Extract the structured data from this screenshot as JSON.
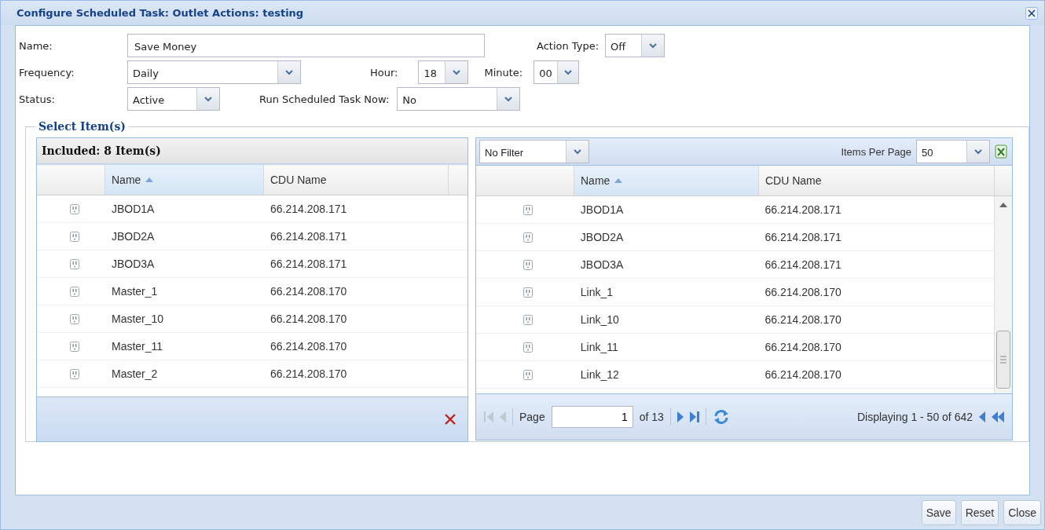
{
  "window": {
    "title": "Configure Scheduled Task: Outlet Actions: testing"
  },
  "form": {
    "name": {
      "label": "Name:",
      "value": "Save Money"
    },
    "action_type": {
      "label": "Action Type:",
      "value": "Off"
    },
    "frequency": {
      "label": "Frequency:",
      "value": "Daily"
    },
    "hour": {
      "label": "Hour:",
      "value": "18"
    },
    "minute": {
      "label": "Minute:",
      "value": "00"
    },
    "status": {
      "label": "Status:",
      "value": "Active"
    },
    "run_now": {
      "label": "Run Scheduled Task Now:",
      "value": "No"
    }
  },
  "fieldset": {
    "legend": "Select Item(s)"
  },
  "included": {
    "title": "Included: 8 Item(s)",
    "columns": [
      {
        "label": "Name",
        "sorted": true
      },
      {
        "label": "CDU Name",
        "sorted": false
      }
    ],
    "rows": [
      {
        "name": "JBOD1A",
        "cdu": "66.214.208.171"
      },
      {
        "name": "JBOD2A",
        "cdu": "66.214.208.171"
      },
      {
        "name": "JBOD3A",
        "cdu": "66.214.208.171"
      },
      {
        "name": "Master_1",
        "cdu": "66.214.208.170"
      },
      {
        "name": "Master_10",
        "cdu": "66.214.208.170"
      },
      {
        "name": "Master_11",
        "cdu": "66.214.208.170"
      },
      {
        "name": "Master_2",
        "cdu": "66.214.208.170"
      }
    ]
  },
  "available": {
    "filter": "No Filter",
    "items_per_page_label": "Items Per Page",
    "items_per_page": "50",
    "columns": [
      {
        "label": "Name",
        "sorted": true
      },
      {
        "label": "CDU Name",
        "sorted": false
      }
    ],
    "rows": [
      {
        "name": "JBOD1A",
        "cdu": "66.214.208.171"
      },
      {
        "name": "JBOD2A",
        "cdu": "66.214.208.171"
      },
      {
        "name": "JBOD3A",
        "cdu": "66.214.208.171"
      },
      {
        "name": "Link_1",
        "cdu": "66.214.208.170"
      },
      {
        "name": "Link_10",
        "cdu": "66.214.208.170"
      },
      {
        "name": "Link_11",
        "cdu": "66.214.208.170"
      },
      {
        "name": "Link_12",
        "cdu": "66.214.208.170"
      }
    ],
    "pager": {
      "page_label": "Page",
      "page": "1",
      "of": "of 13",
      "display": "Displaying 1 - 50 of 642"
    }
  },
  "buttons": [
    "Save",
    "Reset",
    "Close"
  ]
}
